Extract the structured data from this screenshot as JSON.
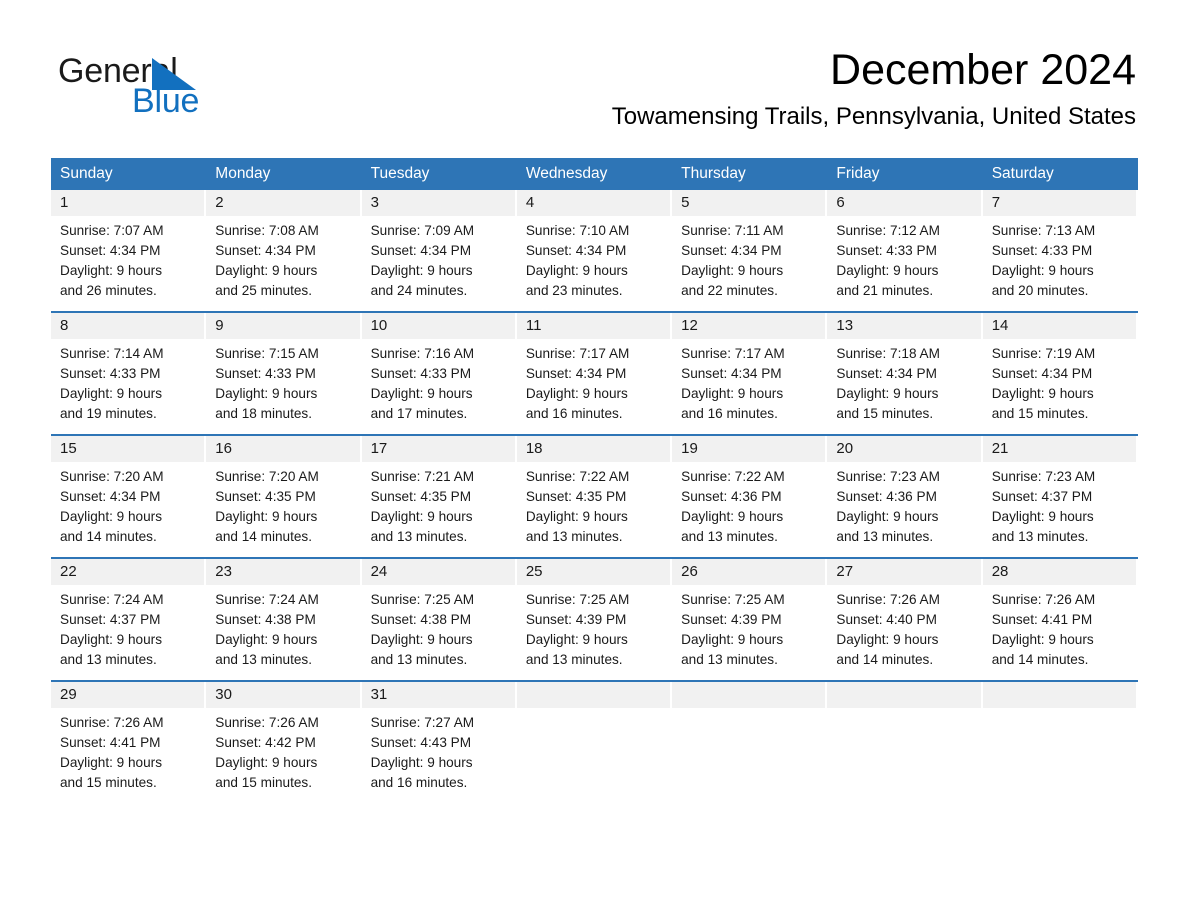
{
  "brand": {
    "name_part1": "General",
    "name_part2": "Blue",
    "accent_color": "#1270bf",
    "triangle_color": "#1270bf"
  },
  "header": {
    "month_title": "December 2024",
    "location": "Towamensing Trails, Pennsylvania, United States",
    "header_bar_color": "#2E75B6",
    "daynum_band_color": "#f1f1f1"
  },
  "weekday_headers": [
    "Sunday",
    "Monday",
    "Tuesday",
    "Wednesday",
    "Thursday",
    "Friday",
    "Saturday"
  ],
  "weeks": [
    [
      {
        "day": "1",
        "sunrise": "Sunrise: 7:07 AM",
        "sunset": "Sunset: 4:34 PM",
        "daylight_line1": "Daylight: 9 hours",
        "daylight_line2": "and 26 minutes."
      },
      {
        "day": "2",
        "sunrise": "Sunrise: 7:08 AM",
        "sunset": "Sunset: 4:34 PM",
        "daylight_line1": "Daylight: 9 hours",
        "daylight_line2": "and 25 minutes."
      },
      {
        "day": "3",
        "sunrise": "Sunrise: 7:09 AM",
        "sunset": "Sunset: 4:34 PM",
        "daylight_line1": "Daylight: 9 hours",
        "daylight_line2": "and 24 minutes."
      },
      {
        "day": "4",
        "sunrise": "Sunrise: 7:10 AM",
        "sunset": "Sunset: 4:34 PM",
        "daylight_line1": "Daylight: 9 hours",
        "daylight_line2": "and 23 minutes."
      },
      {
        "day": "5",
        "sunrise": "Sunrise: 7:11 AM",
        "sunset": "Sunset: 4:34 PM",
        "daylight_line1": "Daylight: 9 hours",
        "daylight_line2": "and 22 minutes."
      },
      {
        "day": "6",
        "sunrise": "Sunrise: 7:12 AM",
        "sunset": "Sunset: 4:33 PM",
        "daylight_line1": "Daylight: 9 hours",
        "daylight_line2": "and 21 minutes."
      },
      {
        "day": "7",
        "sunrise": "Sunrise: 7:13 AM",
        "sunset": "Sunset: 4:33 PM",
        "daylight_line1": "Daylight: 9 hours",
        "daylight_line2": "and 20 minutes."
      }
    ],
    [
      {
        "day": "8",
        "sunrise": "Sunrise: 7:14 AM",
        "sunset": "Sunset: 4:33 PM",
        "daylight_line1": "Daylight: 9 hours",
        "daylight_line2": "and 19 minutes."
      },
      {
        "day": "9",
        "sunrise": "Sunrise: 7:15 AM",
        "sunset": "Sunset: 4:33 PM",
        "daylight_line1": "Daylight: 9 hours",
        "daylight_line2": "and 18 minutes."
      },
      {
        "day": "10",
        "sunrise": "Sunrise: 7:16 AM",
        "sunset": "Sunset: 4:33 PM",
        "daylight_line1": "Daylight: 9 hours",
        "daylight_line2": "and 17 minutes."
      },
      {
        "day": "11",
        "sunrise": "Sunrise: 7:17 AM",
        "sunset": "Sunset: 4:34 PM",
        "daylight_line1": "Daylight: 9 hours",
        "daylight_line2": "and 16 minutes."
      },
      {
        "day": "12",
        "sunrise": "Sunrise: 7:17 AM",
        "sunset": "Sunset: 4:34 PM",
        "daylight_line1": "Daylight: 9 hours",
        "daylight_line2": "and 16 minutes."
      },
      {
        "day": "13",
        "sunrise": "Sunrise: 7:18 AM",
        "sunset": "Sunset: 4:34 PM",
        "daylight_line1": "Daylight: 9 hours",
        "daylight_line2": "and 15 minutes."
      },
      {
        "day": "14",
        "sunrise": "Sunrise: 7:19 AM",
        "sunset": "Sunset: 4:34 PM",
        "daylight_line1": "Daylight: 9 hours",
        "daylight_line2": "and 15 minutes."
      }
    ],
    [
      {
        "day": "15",
        "sunrise": "Sunrise: 7:20 AM",
        "sunset": "Sunset: 4:34 PM",
        "daylight_line1": "Daylight: 9 hours",
        "daylight_line2": "and 14 minutes."
      },
      {
        "day": "16",
        "sunrise": "Sunrise: 7:20 AM",
        "sunset": "Sunset: 4:35 PM",
        "daylight_line1": "Daylight: 9 hours",
        "daylight_line2": "and 14 minutes."
      },
      {
        "day": "17",
        "sunrise": "Sunrise: 7:21 AM",
        "sunset": "Sunset: 4:35 PM",
        "daylight_line1": "Daylight: 9 hours",
        "daylight_line2": "and 13 minutes."
      },
      {
        "day": "18",
        "sunrise": "Sunrise: 7:22 AM",
        "sunset": "Sunset: 4:35 PM",
        "daylight_line1": "Daylight: 9 hours",
        "daylight_line2": "and 13 minutes."
      },
      {
        "day": "19",
        "sunrise": "Sunrise: 7:22 AM",
        "sunset": "Sunset: 4:36 PM",
        "daylight_line1": "Daylight: 9 hours",
        "daylight_line2": "and 13 minutes."
      },
      {
        "day": "20",
        "sunrise": "Sunrise: 7:23 AM",
        "sunset": "Sunset: 4:36 PM",
        "daylight_line1": "Daylight: 9 hours",
        "daylight_line2": "and 13 minutes."
      },
      {
        "day": "21",
        "sunrise": "Sunrise: 7:23 AM",
        "sunset": "Sunset: 4:37 PM",
        "daylight_line1": "Daylight: 9 hours",
        "daylight_line2": "and 13 minutes."
      }
    ],
    [
      {
        "day": "22",
        "sunrise": "Sunrise: 7:24 AM",
        "sunset": "Sunset: 4:37 PM",
        "daylight_line1": "Daylight: 9 hours",
        "daylight_line2": "and 13 minutes."
      },
      {
        "day": "23",
        "sunrise": "Sunrise: 7:24 AM",
        "sunset": "Sunset: 4:38 PM",
        "daylight_line1": "Daylight: 9 hours",
        "daylight_line2": "and 13 minutes."
      },
      {
        "day": "24",
        "sunrise": "Sunrise: 7:25 AM",
        "sunset": "Sunset: 4:38 PM",
        "daylight_line1": "Daylight: 9 hours",
        "daylight_line2": "and 13 minutes."
      },
      {
        "day": "25",
        "sunrise": "Sunrise: 7:25 AM",
        "sunset": "Sunset: 4:39 PM",
        "daylight_line1": "Daylight: 9 hours",
        "daylight_line2": "and 13 minutes."
      },
      {
        "day": "26",
        "sunrise": "Sunrise: 7:25 AM",
        "sunset": "Sunset: 4:39 PM",
        "daylight_line1": "Daylight: 9 hours",
        "daylight_line2": "and 13 minutes."
      },
      {
        "day": "27",
        "sunrise": "Sunrise: 7:26 AM",
        "sunset": "Sunset: 4:40 PM",
        "daylight_line1": "Daylight: 9 hours",
        "daylight_line2": "and 14 minutes."
      },
      {
        "day": "28",
        "sunrise": "Sunrise: 7:26 AM",
        "sunset": "Sunset: 4:41 PM",
        "daylight_line1": "Daylight: 9 hours",
        "daylight_line2": "and 14 minutes."
      }
    ],
    [
      {
        "day": "29",
        "sunrise": "Sunrise: 7:26 AM",
        "sunset": "Sunset: 4:41 PM",
        "daylight_line1": "Daylight: 9 hours",
        "daylight_line2": "and 15 minutes."
      },
      {
        "day": "30",
        "sunrise": "Sunrise: 7:26 AM",
        "sunset": "Sunset: 4:42 PM",
        "daylight_line1": "Daylight: 9 hours",
        "daylight_line2": "and 15 minutes."
      },
      {
        "day": "31",
        "sunrise": "Sunrise: 7:27 AM",
        "sunset": "Sunset: 4:43 PM",
        "daylight_line1": "Daylight: 9 hours",
        "daylight_line2": "and 16 minutes."
      },
      {
        "day": "",
        "sunrise": "",
        "sunset": "",
        "daylight_line1": "",
        "daylight_line2": ""
      },
      {
        "day": "",
        "sunrise": "",
        "sunset": "",
        "daylight_line1": "",
        "daylight_line2": ""
      },
      {
        "day": "",
        "sunrise": "",
        "sunset": "",
        "daylight_line1": "",
        "daylight_line2": ""
      },
      {
        "day": "",
        "sunrise": "",
        "sunset": "",
        "daylight_line1": "",
        "daylight_line2": ""
      }
    ]
  ]
}
